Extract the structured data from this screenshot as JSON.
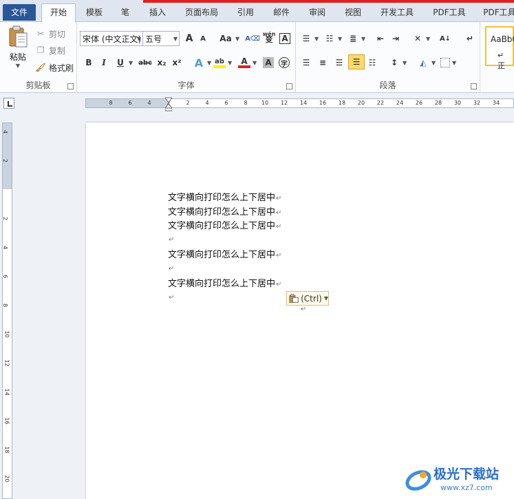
{
  "tabs": {
    "file": "文件",
    "home": "开始",
    "template": "模板",
    "pen": "笔",
    "insert": "插入",
    "page_layout": "页面布局",
    "references": "引用",
    "mailings": "邮件",
    "review": "审阅",
    "view": "视图",
    "developer": "开发工具",
    "pdf_tools_1": "PDF工具",
    "pdf_tools_2": "PDF工具"
  },
  "clipboard": {
    "paste": "粘贴",
    "cut": "剪切",
    "copy": "复制",
    "format_painter": "格式刷",
    "group_label": "剪贴板"
  },
  "font": {
    "font_name": "宋体 (中文正文)",
    "font_size": "五号",
    "group_label": "字体",
    "bold": "B",
    "italic": "I",
    "underline": "U",
    "strike": "abc",
    "subscript": "x₂",
    "superscript": "x²",
    "grow": "A",
    "shrink": "A",
    "change_case": "Aa",
    "phonetic": "wén",
    "char_border": "A",
    "char_shading": "A",
    "enclose": "字",
    "highlight": "ab"
  },
  "paragraph": {
    "group_label": "段落"
  },
  "styles": {
    "preview": "AaBbC",
    "normal": "↵ 正"
  },
  "ruler": {
    "h_ticks": [
      "8",
      "6",
      "4",
      "2",
      "2",
      "4",
      "6",
      "8",
      "10",
      "12",
      "14",
      "16",
      "18",
      "20",
      "22",
      "24",
      "26",
      "28",
      "30",
      "32",
      "34"
    ],
    "v_ticks": [
      "4",
      "2",
      "2",
      "4",
      "6",
      "8",
      "10",
      "12",
      "14",
      "16",
      "18",
      "20"
    ]
  },
  "document": {
    "lines": [
      "文字横向打印怎么上下居中",
      "文字横向打印怎么上下居中",
      "文字横向打印怎么上下居中",
      "",
      "文字横向打印怎么上下居中",
      "",
      "文字横向打印怎么上下居中",
      ""
    ],
    "paragraph_mark": "↵"
  },
  "paste_options": {
    "label": "(Ctrl)"
  },
  "watermark": {
    "name": "极光下载站",
    "url": "www.xz7.com"
  }
}
